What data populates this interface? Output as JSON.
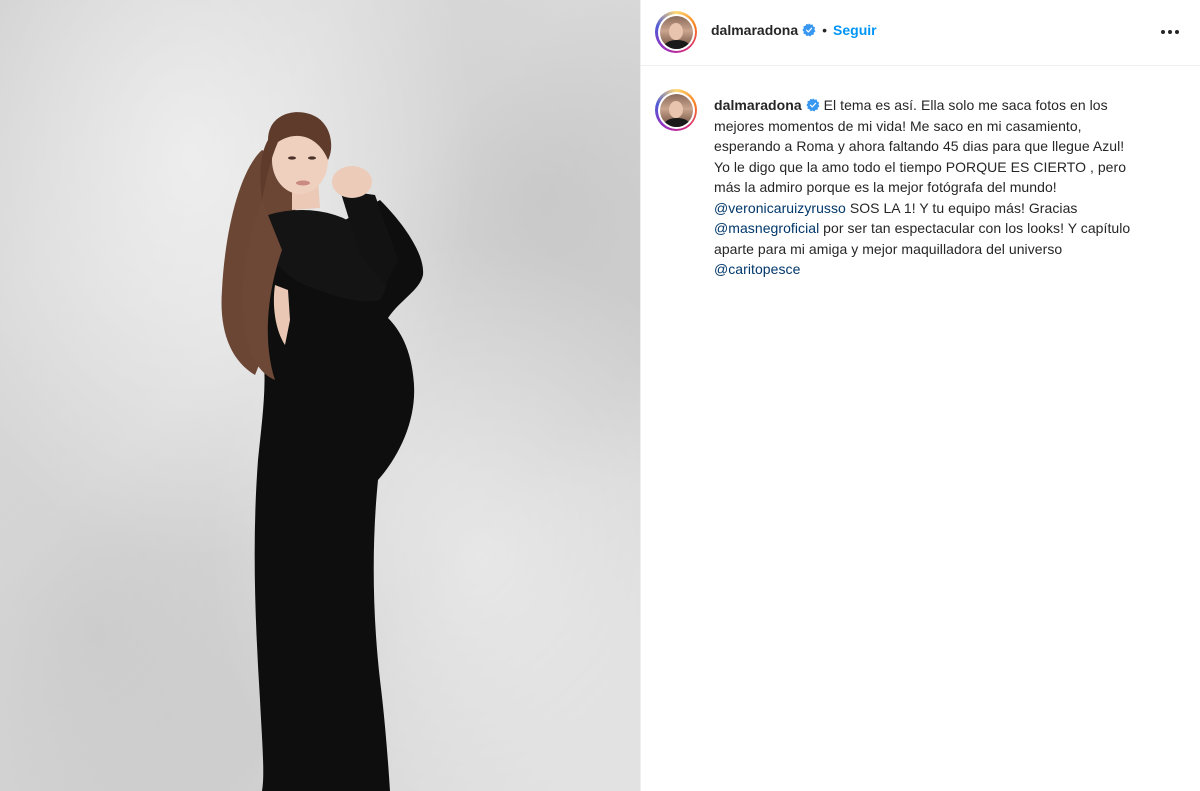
{
  "post": {
    "author": "dalmaradona",
    "follow_label": "Seguir",
    "dot": "•",
    "caption_lines": [
      {
        "text": "El tema es así. Ella solo me saca fotos en los"
      },
      {
        "text": "mejores momentos de mi vida! Me saco en mi casamiento,"
      },
      {
        "text": "esperando a Roma y ahora faltando 45 dias para que llegue Azul!"
      },
      {
        "text": "Yo le digo que la amo todo el tiempo PORQUE ES CIERTO , pero"
      },
      {
        "text": "más la admiro porque es la mejor fotógrafa del mundo!"
      },
      {
        "mention": "@veronicaruizyrusso",
        "text": " SOS LA 1! Y tu equipo más! Gracias"
      },
      {
        "mention": "@masnegroficial",
        "text": " por ser tan espectacular con los looks! Y capítulo"
      },
      {
        "text": "aparte para mi amiga y mejor maquilladora del universo"
      },
      {
        "mention": "@caritopesce",
        "text": ""
      }
    ]
  },
  "colors": {
    "accent": "#0095f6",
    "verified": "#3897f0",
    "mention": "#00376b",
    "text": "#262626"
  },
  "icons": {
    "verified": "verified-badge-icon",
    "more": "more-options-icon"
  }
}
